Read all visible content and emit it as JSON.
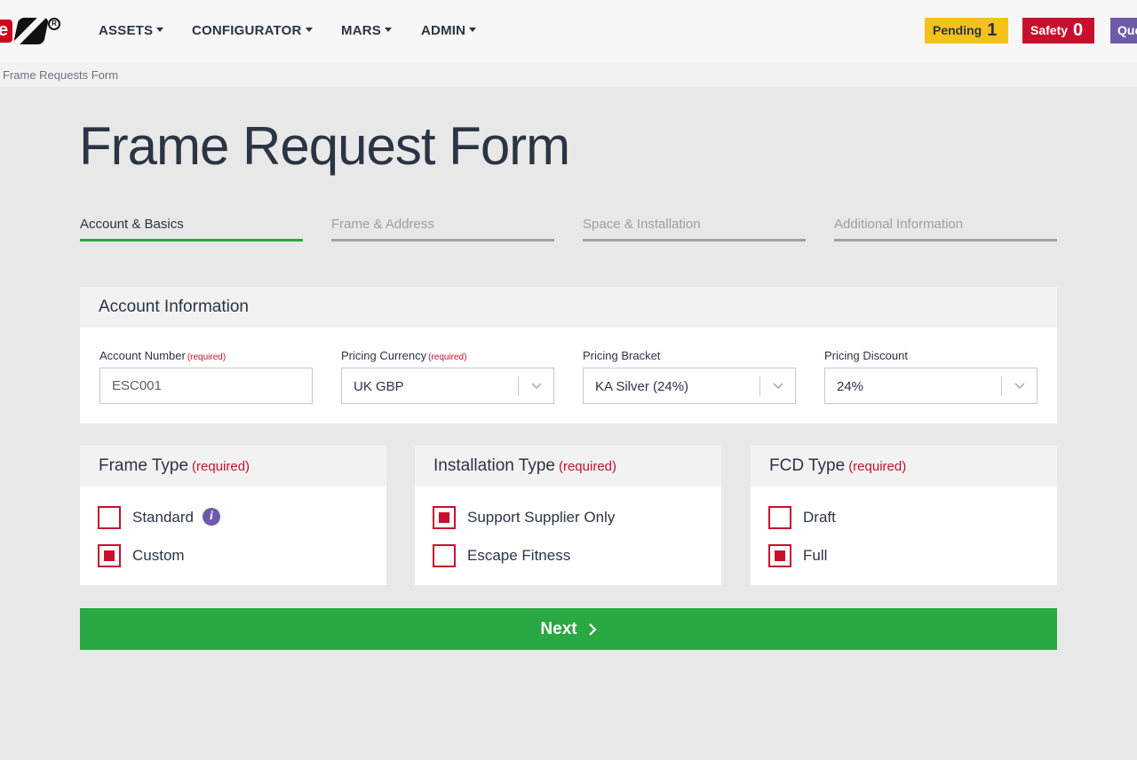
{
  "nav": {
    "items": [
      {
        "label": "ASSETS"
      },
      {
        "label": "CONFIGURATOR"
      },
      {
        "label": "MARS"
      },
      {
        "label": "ADMIN"
      }
    ],
    "badges": {
      "pending": {
        "label": "Pending",
        "count": "1",
        "color": "#f5c21b"
      },
      "safety": {
        "label": "Safety",
        "count": "0",
        "color": "#c8102e"
      },
      "queue": {
        "label": "Que",
        "color": "#6f5aa8"
      }
    },
    "logo_letter": "e"
  },
  "breadcrumb": "Frame Requests Form",
  "page_title": "Frame Request Form",
  "steps": [
    {
      "label": "Account & Basics",
      "active": true
    },
    {
      "label": "Frame & Address",
      "active": false
    },
    {
      "label": "Space & Installation",
      "active": false
    },
    {
      "label": "Additional Information",
      "active": false
    }
  ],
  "account": {
    "title": "Account Information",
    "required_text": "(required)",
    "account_number": {
      "label": "Account Number",
      "value": "ESC001"
    },
    "pricing_currency": {
      "label": "Pricing Currency",
      "value": "UK GBP"
    },
    "pricing_bracket": {
      "label": "Pricing Bracket",
      "value": "KA Silver (24%)"
    },
    "pricing_discount": {
      "label": "Pricing Discount",
      "value": "24%"
    }
  },
  "frame_type": {
    "title": "Frame Type",
    "required_text": "(required)",
    "options": [
      {
        "label": "Standard",
        "checked": false
      },
      {
        "label": "Custom",
        "checked": true
      }
    ],
    "info_glyph": "i"
  },
  "installation_type": {
    "title": "Installation Type",
    "required_text": "(required)",
    "options": [
      {
        "label": "Support Supplier Only",
        "checked": true
      },
      {
        "label": "Escape Fitness",
        "checked": false
      }
    ]
  },
  "fcd_type": {
    "title": "FCD Type",
    "required_text": "(required)",
    "options": [
      {
        "label": "Draft",
        "checked": false
      },
      {
        "label": "Full",
        "checked": true
      }
    ]
  },
  "next_label": "Next",
  "colors": {
    "accent_green": "#2aa843",
    "required_red": "#c8102e",
    "text_dark": "#2b3445"
  }
}
